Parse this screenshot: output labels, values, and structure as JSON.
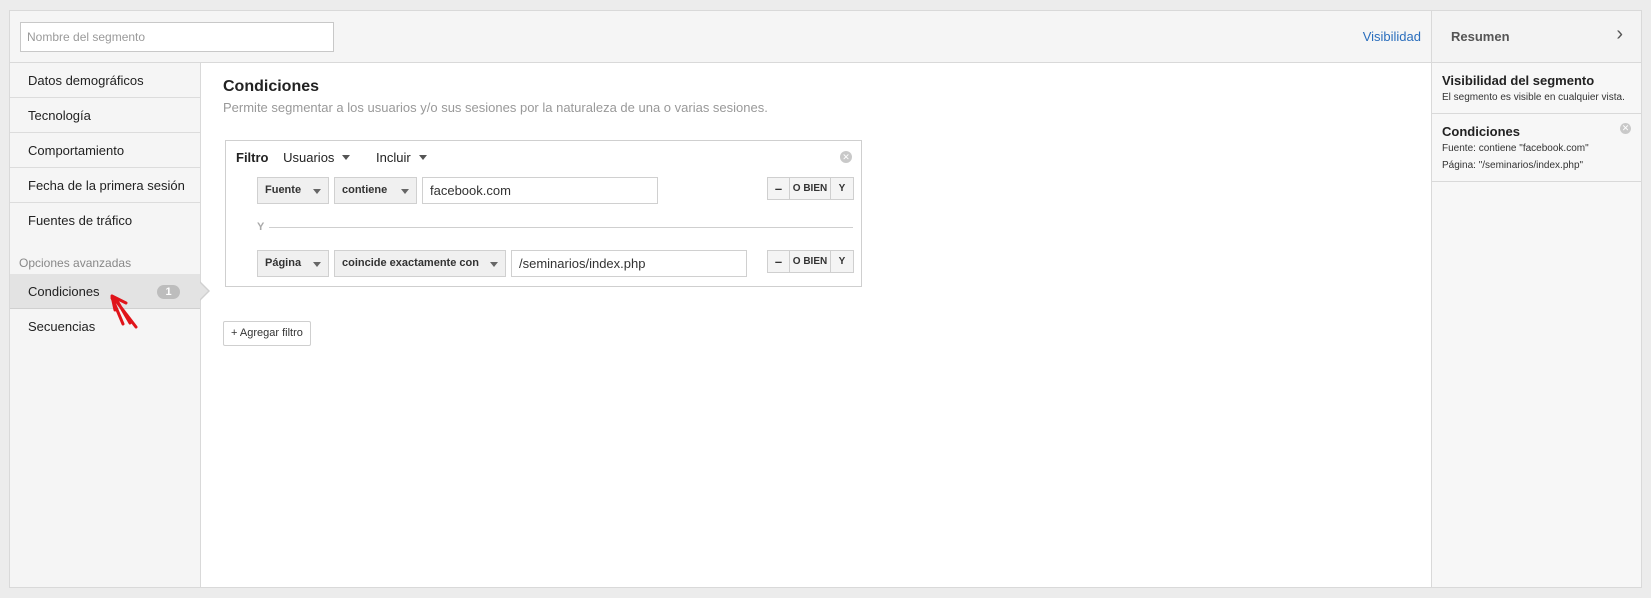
{
  "segment_name": {
    "placeholder": "Nombre del segmento",
    "value": ""
  },
  "header": {
    "visibility_link": "Visibilidad"
  },
  "sidebar": {
    "items": [
      {
        "label": "Datos demográficos"
      },
      {
        "label": "Tecnología"
      },
      {
        "label": "Comportamiento"
      },
      {
        "label": "Fecha de la primera sesión"
      },
      {
        "label": "Fuentes de tráfico"
      }
    ],
    "advanced_label": "Opciones avanzadas",
    "advanced_items": [
      {
        "label": "Condiciones",
        "badge": "1",
        "active": true
      },
      {
        "label": "Secuencias"
      }
    ]
  },
  "main": {
    "title": "Condiciones",
    "description": "Permite segmentar a los usuarios y/o sus sesiones por la naturaleza de una o varias sesiones.",
    "filter": {
      "label": "Filtro",
      "scope": "Usuarios",
      "mode": "Incluir",
      "close_icon": "close-icon",
      "conditions": [
        {
          "dimension": "Fuente",
          "operator": "contiene",
          "value": "facebook.com"
        },
        {
          "dimension": "Página",
          "operator": "coincide exactamente con",
          "value": "/seminarios/index.php"
        }
      ],
      "and_separator": "Y",
      "buttons": {
        "remove": "–",
        "or": "O BIEN",
        "and": "Y"
      }
    },
    "add_filter_label": "+ Agregar filtro"
  },
  "summary": {
    "title": "Resumen",
    "chevron_icon": "chevron-right-icon",
    "visibility": {
      "heading": "Visibilidad del segmento",
      "text": "El segmento es visible en cualquier vista."
    },
    "conditions": {
      "heading": "Condiciones",
      "lines": [
        "Fuente: contiene \"facebook.com\"",
        "Página: \"/seminarios/index.php\""
      ]
    }
  },
  "colors": {
    "link": "#2a6ebd",
    "panel_bg": "#f5f5f5",
    "border": "#d9d9d9",
    "annotation_arrow": "#e0141a"
  }
}
